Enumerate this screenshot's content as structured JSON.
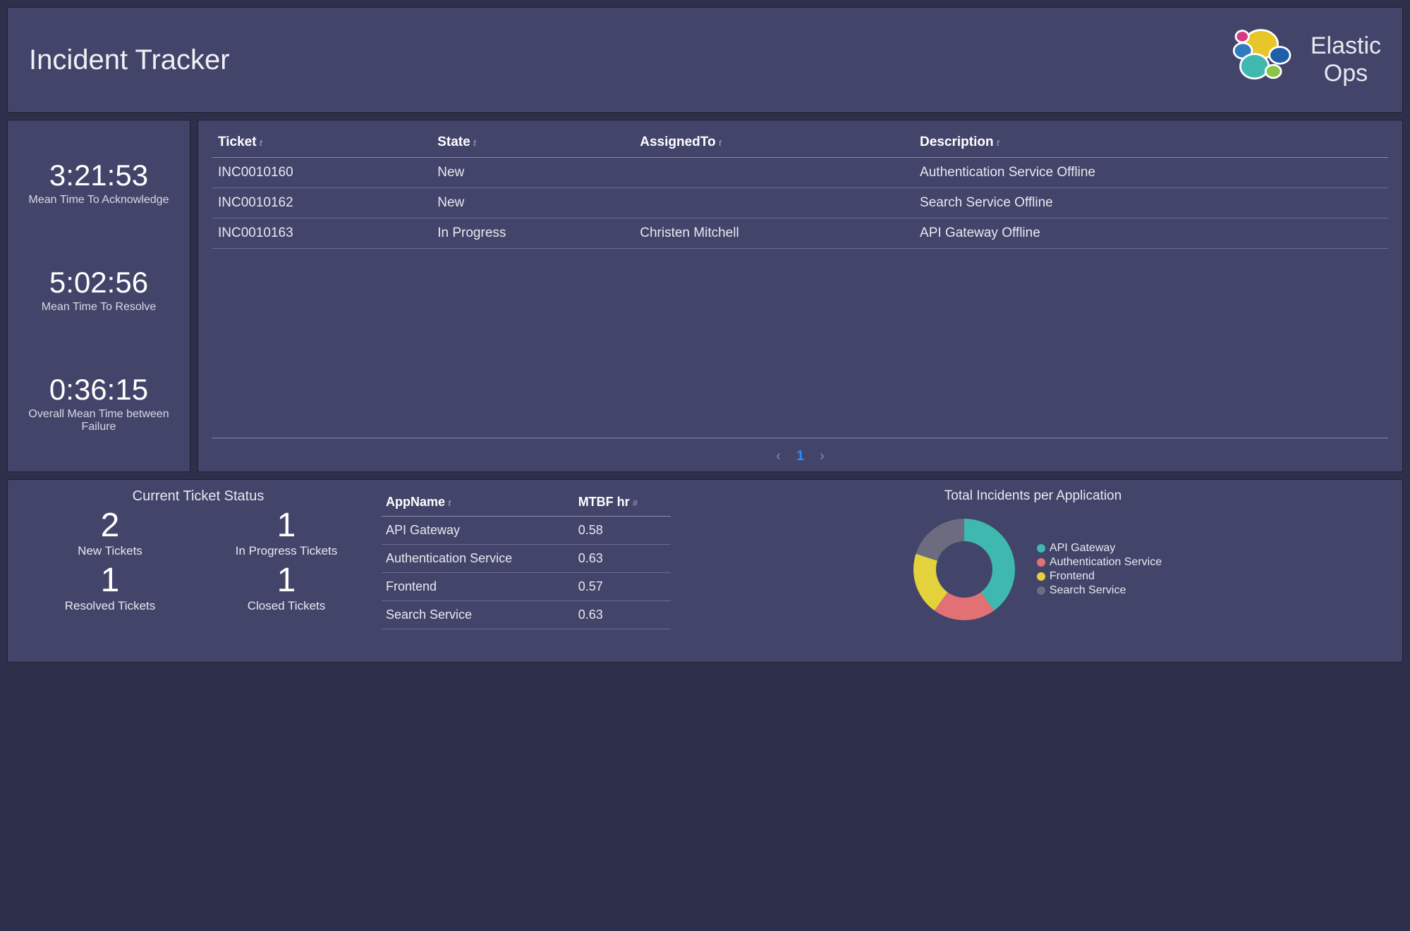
{
  "header": {
    "title": "Incident Tracker",
    "brand_line1": "Elastic",
    "brand_line2": "Ops"
  },
  "metrics": [
    {
      "value": "3:21:53",
      "label": "Mean Time To Acknowledge"
    },
    {
      "value": "5:02:56",
      "label": "Mean Time To Resolve"
    },
    {
      "value": "0:36:15",
      "label": "Overall Mean Time between Failure"
    }
  ],
  "ticket_table": {
    "headers": [
      "Ticket",
      "State",
      "AssignedTo",
      "Description"
    ],
    "rows": [
      {
        "ticket": "INC0010160",
        "state": "New",
        "assigned": "",
        "desc": "Authentication Service Offline"
      },
      {
        "ticket": "INC0010162",
        "state": "New",
        "assigned": "",
        "desc": "Search Service Offline"
      },
      {
        "ticket": "INC0010163",
        "state": "In Progress",
        "assigned": "Christen Mitchell",
        "desc": "API Gateway Offline"
      }
    ],
    "page": "1"
  },
  "status": {
    "title": "Current Ticket Status",
    "cells": [
      {
        "num": "2",
        "label": "New Tickets"
      },
      {
        "num": "1",
        "label": "In Progress Tickets"
      },
      {
        "num": "1",
        "label": "Resolved Tickets"
      },
      {
        "num": "1",
        "label": "Closed Tickets"
      }
    ]
  },
  "mtbf": {
    "headers": [
      "AppName",
      "MTBF hr"
    ],
    "rows": [
      {
        "app": "API Gateway",
        "hr": "0.58"
      },
      {
        "app": "Authentication Service",
        "hr": "0.63"
      },
      {
        "app": "Frontend",
        "hr": "0.57"
      },
      {
        "app": "Search Service",
        "hr": "0.63"
      }
    ]
  },
  "donut": {
    "title": "Total Incidents per Application",
    "legend": [
      {
        "label": "API Gateway",
        "color": "#3fb8af"
      },
      {
        "label": "Authentication Service",
        "color": "#e27176"
      },
      {
        "label": "Frontend",
        "color": "#e3d23b"
      },
      {
        "label": "Search Service",
        "color": "#6b6c80"
      }
    ]
  },
  "chart_data": {
    "type": "pie",
    "title": "Total Incidents per Application",
    "series": [
      {
        "name": "API Gateway",
        "value": 40,
        "color": "#3fb8af"
      },
      {
        "name": "Authentication Service",
        "value": 20,
        "color": "#e27176"
      },
      {
        "name": "Frontend",
        "value": 20,
        "color": "#e3d23b"
      },
      {
        "name": "Search Service",
        "value": 20,
        "color": "#6b6c80"
      }
    ],
    "note": "values are approximate percentages read from arc lengths"
  }
}
